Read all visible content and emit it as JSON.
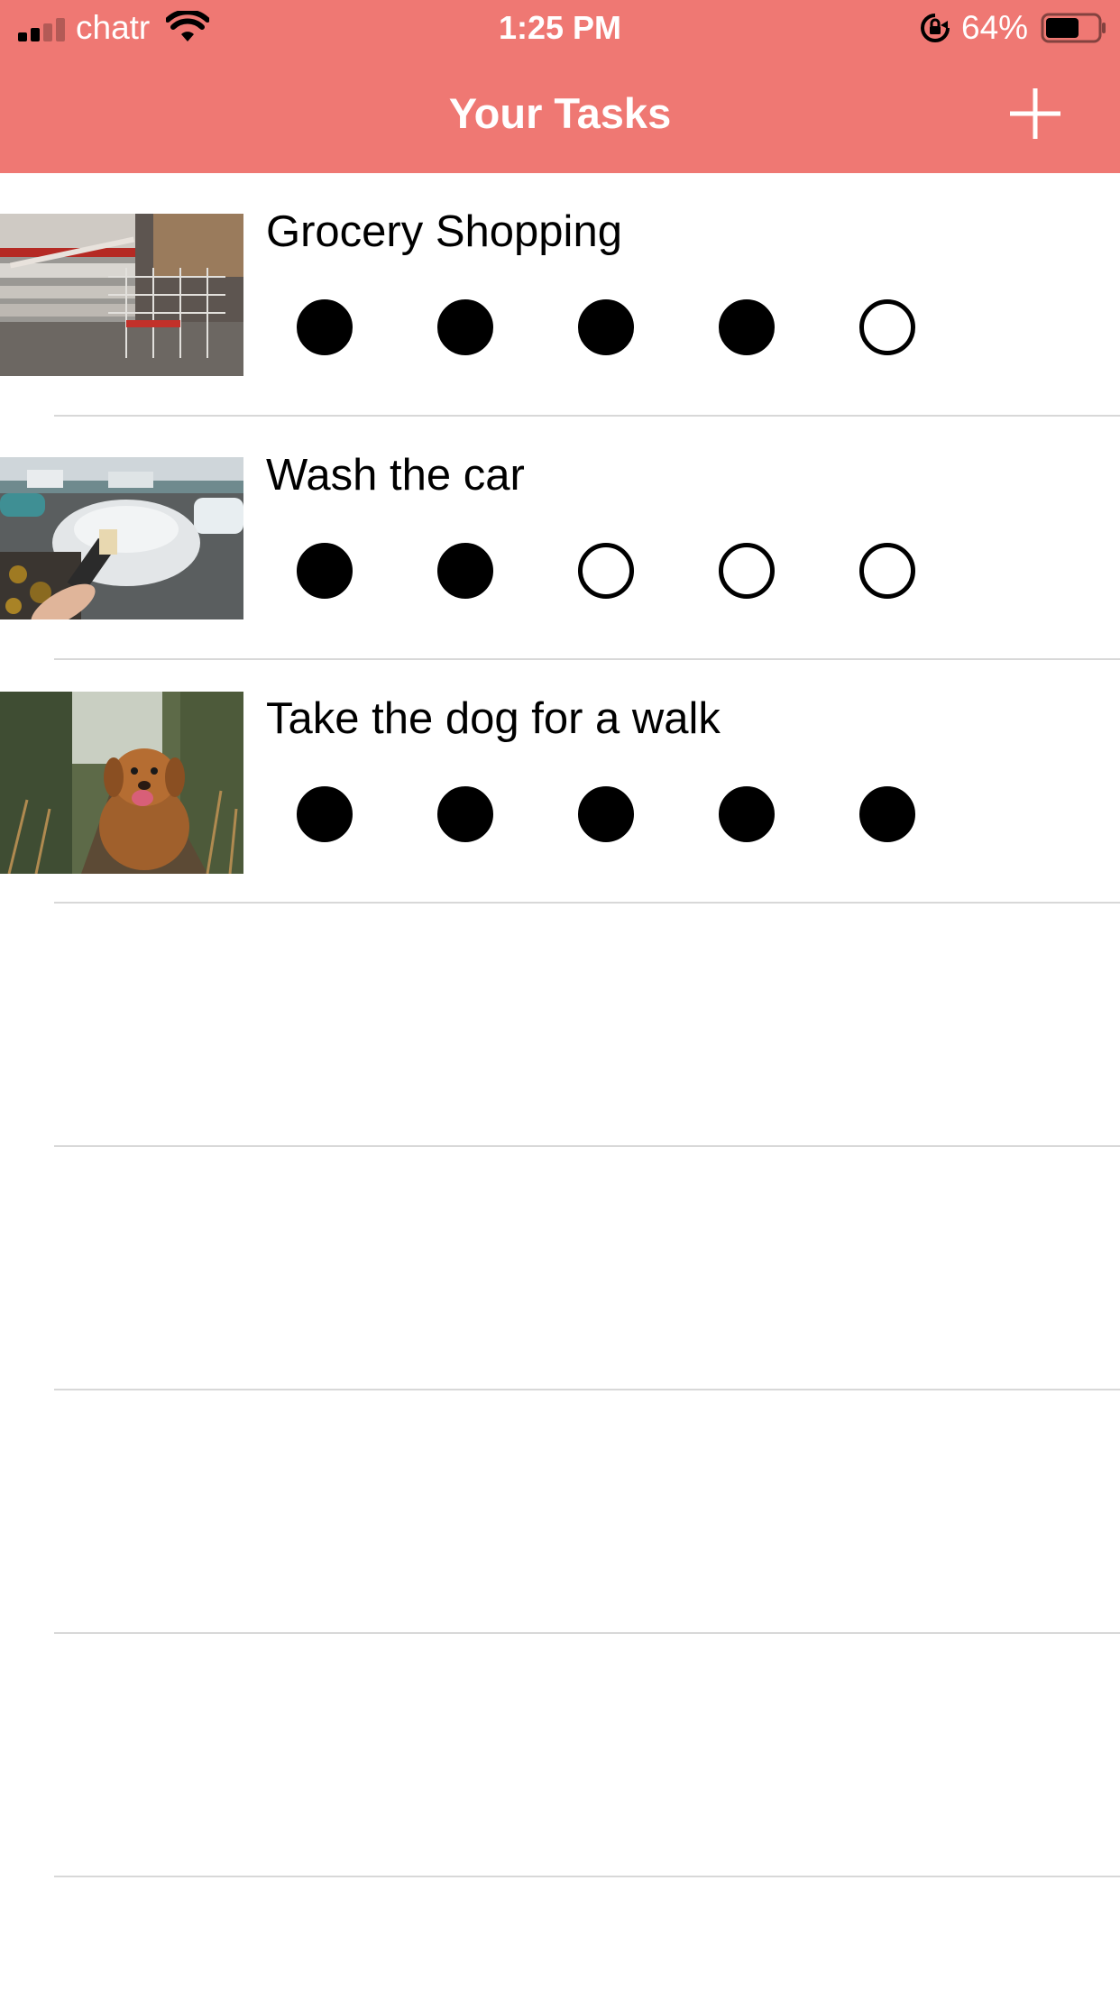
{
  "status_bar": {
    "carrier": "chatr",
    "time": "1:25 PM",
    "battery_percent": "64%",
    "signal_bars_active": 2,
    "signal_bars_total": 4,
    "battery_level": 0.64
  },
  "nav": {
    "title": "Your Tasks",
    "add_icon": "plus-icon"
  },
  "colors": {
    "header_bg": "#ef7873",
    "header_text": "#ffffff",
    "separator": "#d8d8d8",
    "dot": "#000000"
  },
  "tasks": [
    {
      "title": "Grocery Shopping",
      "image": "grocery-cart-photo",
      "progress": [
        true,
        true,
        true,
        true,
        false
      ]
    },
    {
      "title": "Wash the car",
      "image": "car-wash-photo",
      "progress": [
        true,
        true,
        false,
        false,
        false
      ]
    },
    {
      "title": "Take the dog for a walk",
      "image": "dog-photo",
      "progress": [
        true,
        true,
        true,
        true,
        true
      ]
    }
  ],
  "empty_rows": 4
}
